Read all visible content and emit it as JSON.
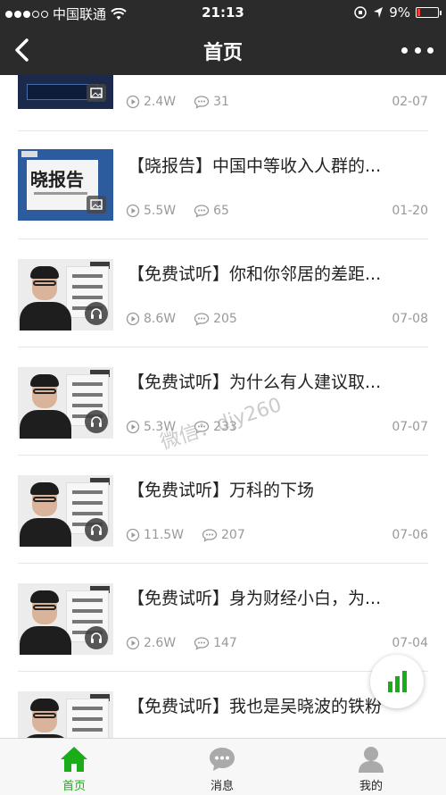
{
  "status_bar": {
    "carrier": "中国联通",
    "time": "21:13",
    "battery": "9%"
  },
  "nav": {
    "title": "首页"
  },
  "items": [
    {
      "title": "",
      "plays": "2.4W",
      "comments": "31",
      "date": "02-07",
      "thumb": "dark",
      "badge": "image-icon"
    },
    {
      "title": "【晓报告】中国中等收入人群的...",
      "plays": "5.5W",
      "comments": "65",
      "date": "01-20",
      "thumb": "report",
      "thumb_text": "晓报告",
      "badge": "image-icon"
    },
    {
      "title": "【免费试听】你和你邻居的差距...",
      "plays": "8.6W",
      "comments": "205",
      "date": "07-08",
      "thumb": "portrait",
      "badge": "headphones-icon"
    },
    {
      "title": "【免费试听】为什么有人建议取...",
      "plays": "5.3W",
      "comments": "233",
      "date": "07-07",
      "thumb": "portrait",
      "badge": "headphones-icon"
    },
    {
      "title": "【免费试听】万科的下场",
      "plays": "11.5W",
      "comments": "207",
      "date": "07-06",
      "thumb": "portrait",
      "badge": "headphones-icon"
    },
    {
      "title": "【免费试听】身为财经小白，为...",
      "plays": "2.6W",
      "comments": "147",
      "date": "07-04",
      "thumb": "portrait",
      "badge": "headphones-icon"
    },
    {
      "title": "【免费试听】我也是吴晓波的铁粉",
      "plays": "",
      "comments": "",
      "date": "",
      "thumb": "portrait",
      "badge": "headphones-icon"
    }
  ],
  "watermark": "微信：djy260",
  "tabs": [
    {
      "label": "首页",
      "icon": "home-icon",
      "active": true
    },
    {
      "label": "消息",
      "icon": "chat-icon",
      "active": false
    },
    {
      "label": "我的",
      "icon": "person-icon",
      "active": false
    }
  ],
  "colors": {
    "header": "#2b2b2b",
    "accent": "#1aad19",
    "meta": "#999999"
  }
}
